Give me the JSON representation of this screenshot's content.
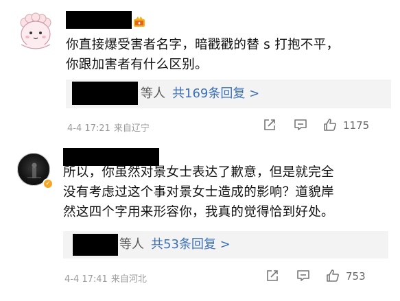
{
  "comments": [
    {
      "text_lines": [
        "你直接爆受害者名字，暗戳戳的替 s 打抱不平，",
        "你跟加害者有什么区别。"
      ],
      "reply_people": "等人",
      "reply_count": "共169条回复 >",
      "time": "4-4 17:21",
      "source": "来自辽宁",
      "likes": "1175"
    },
    {
      "text_lines": [
        "所以，你虽然对景女士表达了歉意，但是就完全",
        "没有考虑过这个事对景女士造成的影响？道貌岸",
        "然这四个字用来形容你，我真的觉得恰到好处。"
      ],
      "reply_people": "等人",
      "reply_count": "共53条回复 >",
      "time": "4-4 17:41",
      "source": "来自河北",
      "likes": "753"
    }
  ],
  "colors": {
    "link": "#3b6fb6",
    "meta": "#9a9a9a",
    "reply_bg": "#f3f3f3",
    "verified": "#f5a623"
  },
  "icons": [
    "cartoon-avatar",
    "verified-badge",
    "member-badge-icon",
    "share-icon",
    "comment-icon",
    "like-icon"
  ]
}
